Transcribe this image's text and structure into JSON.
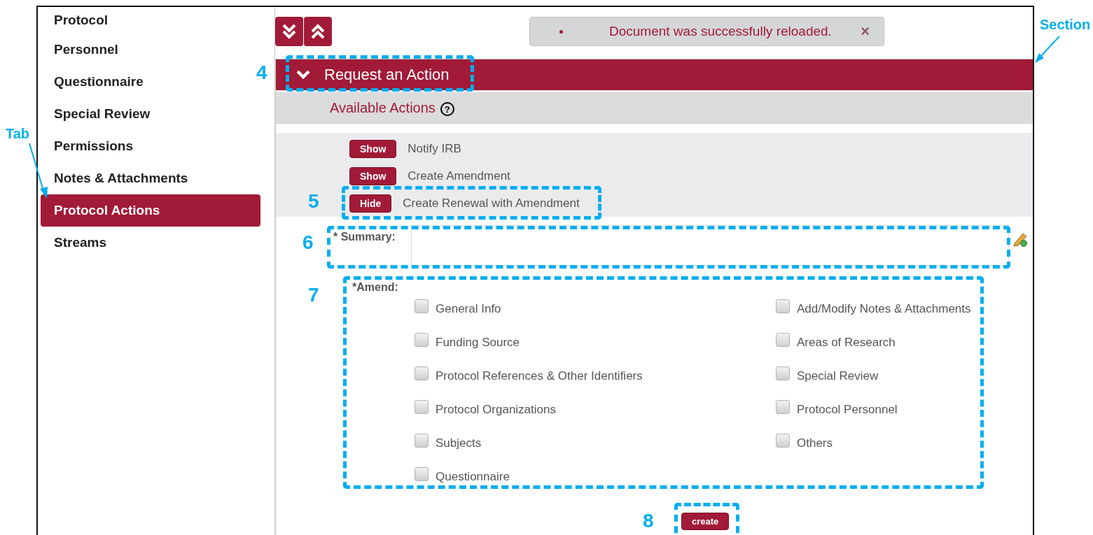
{
  "sidebar": {
    "items": [
      {
        "label": "Protocol",
        "selected": false
      },
      {
        "label": "Personnel",
        "selected": false
      },
      {
        "label": "Questionnaire",
        "selected": false
      },
      {
        "label": "Special Review",
        "selected": false
      },
      {
        "label": "Permissions",
        "selected": false
      },
      {
        "label": "Notes & Attachments",
        "selected": false
      },
      {
        "label": "Protocol Actions",
        "selected": true
      },
      {
        "label": "Streams",
        "selected": false
      }
    ]
  },
  "message": {
    "text": "Document was successfully reloaded.",
    "close": "×"
  },
  "section": {
    "title": "Request an Action",
    "expanded": true,
    "subheader": "Available Actions",
    "help": "?"
  },
  "actions": [
    {
      "button": "Show",
      "label": "Notify IRB"
    },
    {
      "button": "Show",
      "label": "Create Amendment"
    },
    {
      "button": "Hide",
      "label": "Create Renewal with Amendment"
    }
  ],
  "summary": {
    "label": "* Summary:"
  },
  "amend": {
    "label": "*Amend:",
    "columns": [
      [
        {
          "label": "General Info",
          "checked": false
        },
        {
          "label": "Funding Source",
          "checked": false
        },
        {
          "label": "Protocol References & Other Identifiers",
          "checked": false
        },
        {
          "label": "Protocol Organizations",
          "checked": false
        },
        {
          "label": "Subjects",
          "checked": false
        },
        {
          "label": "Questionnaire",
          "checked": false
        }
      ],
      [
        {
          "label": "Add/Modify Notes & Attachments",
          "checked": false
        },
        {
          "label": "Areas of Research",
          "checked": false
        },
        {
          "label": "Special Review",
          "checked": false
        },
        {
          "label": "Protocol Personnel",
          "checked": false
        },
        {
          "label": "Others",
          "checked": false
        }
      ]
    ]
  },
  "create_button": "create",
  "annotations": [
    {
      "label": "4"
    },
    {
      "label": "5"
    },
    {
      "label": "6"
    },
    {
      "label": "7"
    },
    {
      "label": "8"
    }
  ],
  "callouts": [
    {
      "label": "Tab"
    },
    {
      "label": "Section"
    }
  ]
}
